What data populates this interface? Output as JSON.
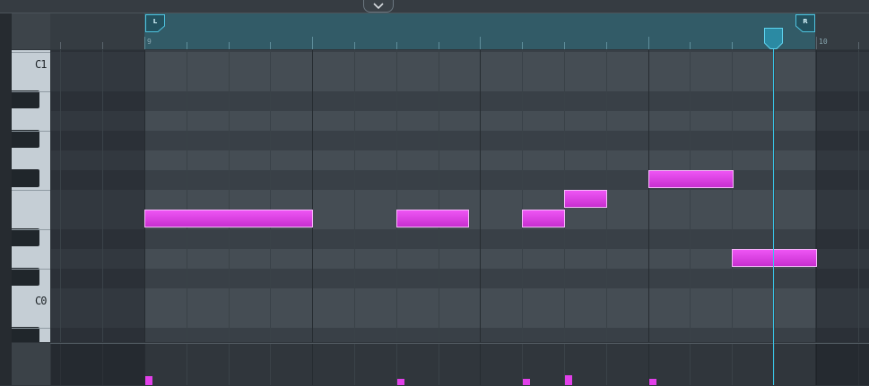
{
  "toolbar": {
    "collapse_icon": "chevron-down-icon"
  },
  "timeline": {
    "bar_numbers": [
      "9",
      "10"
    ],
    "loop_start_label": "L",
    "loop_end_label": "R"
  },
  "piano": {
    "octave_labels": [
      "C1",
      "C0"
    ]
  },
  "colors": {
    "note_fill": "#e040e8",
    "loop_region": "#325b67",
    "playhead": "#38c4e6",
    "velocity": "#e240ea"
  },
  "notes": [
    {
      "pitch": "E0",
      "start_step": 0,
      "length_steps": 4,
      "velocity": 0.9
    },
    {
      "pitch": "E0",
      "start_step": 6,
      "length_steps": 1.7,
      "velocity": 0.6
    },
    {
      "pitch": "E0",
      "start_step": 9,
      "length_steps": 1,
      "velocity": 0.6
    },
    {
      "pitch": "F0",
      "start_step": 10,
      "length_steps": 1,
      "velocity": 1.0
    },
    {
      "pitch": "F#0",
      "start_step": 12,
      "length_steps": 2,
      "velocity": 0.6
    },
    {
      "pitch": "D0",
      "start_step": 14,
      "length_steps": 2,
      "velocity": 0.0
    }
  ],
  "playhead_step": 15
}
